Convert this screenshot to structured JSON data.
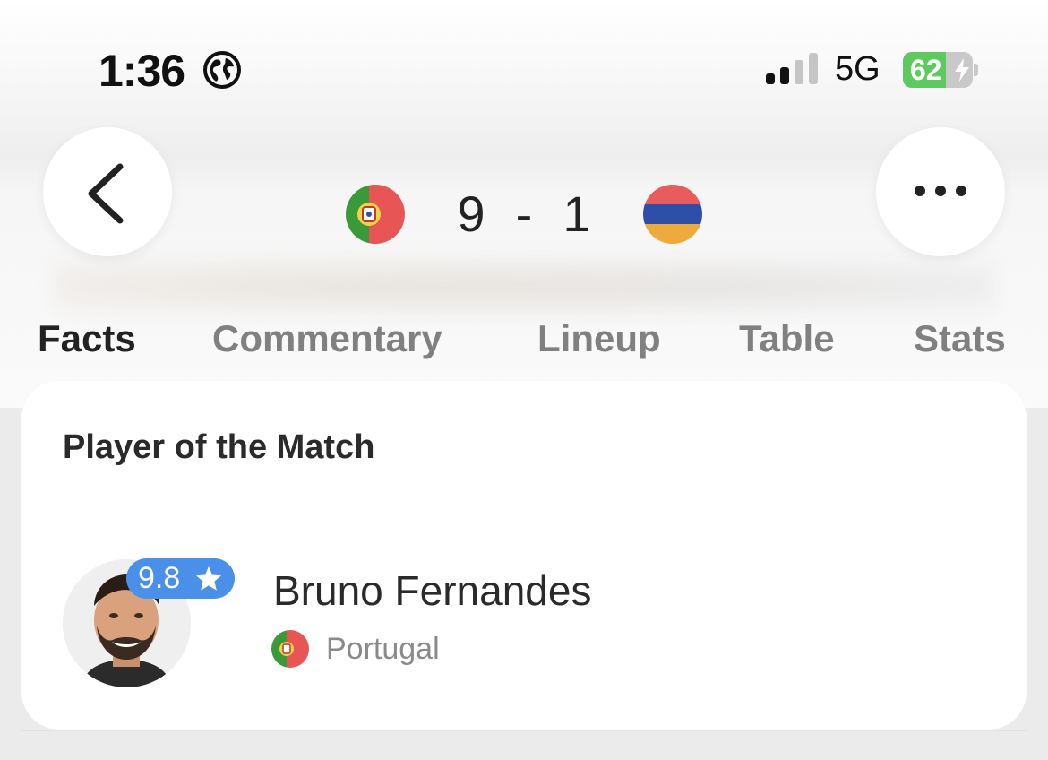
{
  "status_bar": {
    "time": "1:36",
    "network": "5G",
    "battery": "62",
    "battery_level": 0.62,
    "icons": [
      "globe-icon",
      "signal-icon",
      "battery-icon",
      "bolt-icon"
    ]
  },
  "header": {
    "back_icon": "chevron-left-icon",
    "more_icon": "ellipsis-icon",
    "home_team": {
      "flag": "portugal-flag-icon",
      "score": "9"
    },
    "separator": "-",
    "away_team": {
      "flag": "armenia-flag-icon",
      "score": "1"
    }
  },
  "tabs": [
    {
      "label": "Facts",
      "active": true
    },
    {
      "label": "Commentary",
      "active": false
    },
    {
      "label": "Lineup",
      "active": false
    },
    {
      "label": "Table",
      "active": false
    },
    {
      "label": "Stats",
      "active": false
    }
  ],
  "player_of_match": {
    "title": "Player of the Match",
    "rating": "9.8",
    "rating_icon": "star-icon",
    "name": "Bruno Fernandes",
    "country": "Portugal",
    "country_flag": "portugal-flag-icon"
  },
  "colors": {
    "accent": "#4a90e8",
    "battery_green": "#5ec95e",
    "portugal_green": "#3a9a3a",
    "portugal_red": "#e85555",
    "armenia_red": "#e85c5c",
    "armenia_blue": "#2e4fa8",
    "armenia_orange": "#eeaa3c"
  }
}
